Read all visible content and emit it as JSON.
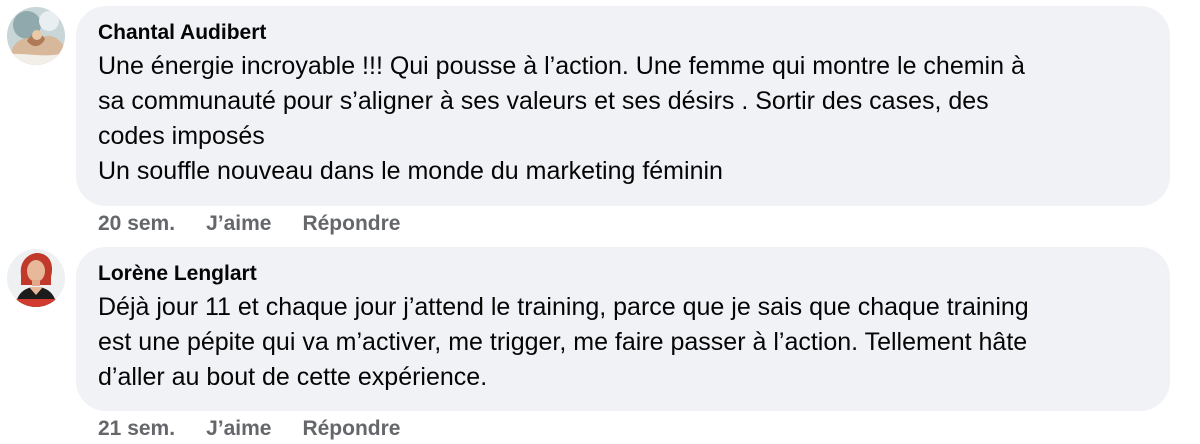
{
  "comments": [
    {
      "author": "Chantal Audibert",
      "lines": [
        "Une énergie incroyable !!! Qui pousse à l’action. Une femme qui montre le chemin à",
        "sa communauté pour s’aligner à ses valeurs et ses désirs . Sortir des cases, des",
        "codes imposés",
        "Un souffle nouveau dans le monde du marketing féminin"
      ],
      "time": "20 sem.",
      "like_label": "J’aime",
      "reply_label": "Répondre",
      "avatar_icon": "profile-photo"
    },
    {
      "author": "Lorène Lenglart",
      "lines": [
        "Déjà jour 11 et chaque jour j’attend le training, parce que je sais que chaque training",
        "est une pépite qui va m’activer, me trigger, me faire passer à l’action. Tellement hâte",
        "d’aller au bout de cette expérience."
      ],
      "time": "21 sem.",
      "like_label": "J’aime",
      "reply_label": "Répondre",
      "avatar_icon": "profile-photo"
    }
  ],
  "colors": {
    "bubble_background": "#f0f2f5",
    "text": "#050505",
    "meta_text": "#65676b"
  }
}
